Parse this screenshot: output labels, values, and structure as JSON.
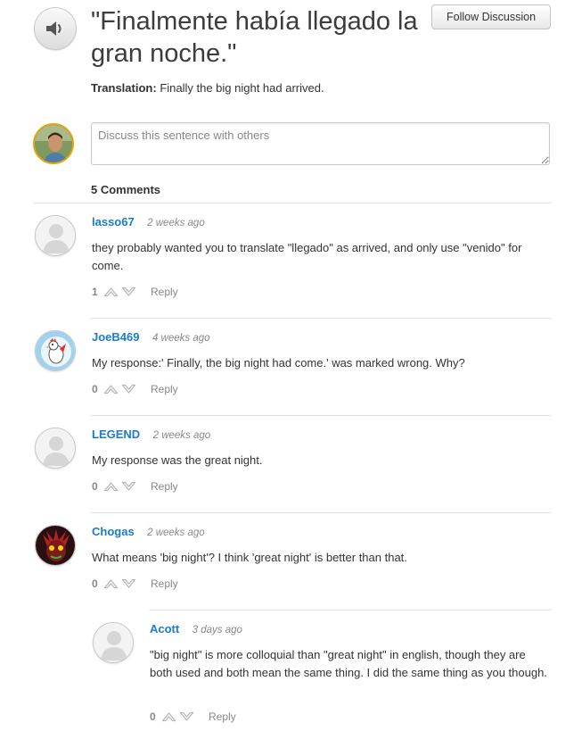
{
  "header": {
    "sentence": "\"Finalmente había llegado la gran noche.\"",
    "follow_button": "Follow Discussion",
    "translation_label": "Translation:",
    "translation_text": "Finally the big night had arrived.",
    "speaker_icon": "speaker-icon"
  },
  "discuss": {
    "placeholder": "Discuss this sentence with others"
  },
  "comments_count": "5 Comments",
  "reply_label": "Reply",
  "comments": [
    {
      "user": "lasso67",
      "time": "2 weeks ago",
      "text": "they probably wanted you to translate \"llegado\" as arrived, and only use \"venido\" for come.",
      "score": "1"
    },
    {
      "user": "JoeB469",
      "time": "4 weeks ago",
      "text": "My response:' Finally, the big night had come.' was marked wrong. Why?",
      "score": "0"
    },
    {
      "user": "LEGEND",
      "time": "2 weeks ago",
      "text": "My response was the great night.",
      "score": "0"
    },
    {
      "user": "Chogas",
      "time": "2 weeks ago",
      "text": "What means 'big night'? I think 'great night' is better than that.",
      "score": "0"
    },
    {
      "user": "Acott",
      "time": "3 days ago",
      "text": "\"big night\" is more colloquial than \"great night\" in english, though they are both used and both mean the same thing. I did the same thing as you though.",
      "score": "0"
    }
  ],
  "colors": {
    "link": "#1a7bd0",
    "muted": "#888888",
    "avatar_ring": "#e8a20c"
  }
}
